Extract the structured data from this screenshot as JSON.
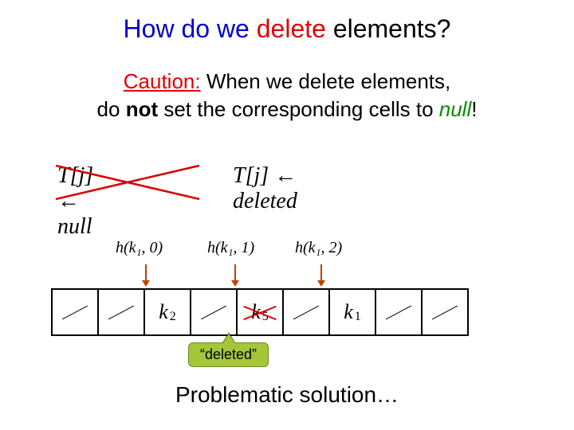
{
  "title": {
    "part1": "How do we",
    "part2": "delete",
    "part3": "elements?"
  },
  "caution": {
    "label": "Caution:",
    "line1_rest": " When we delete elements,",
    "line2_a": "do ",
    "line2_bold": "not",
    "line2_b": " set the corresponding cells to ",
    "null_word": "null",
    "bang": "!"
  },
  "formula": {
    "null_expr": "T[j] ← null",
    "deleted_expr": "T[j] ← deleted"
  },
  "hash": {
    "h1": "h(k₁, 0)",
    "h2": "h(k₁, 1)",
    "h3": "h(k₁, 2)"
  },
  "cells": {
    "k2_k": "k",
    "k2_s": "2",
    "k5_k": "k",
    "k5_s": "5",
    "k1_k": "k",
    "k1_s": "1"
  },
  "callout": "“deleted”",
  "footer": "Problematic solution…"
}
